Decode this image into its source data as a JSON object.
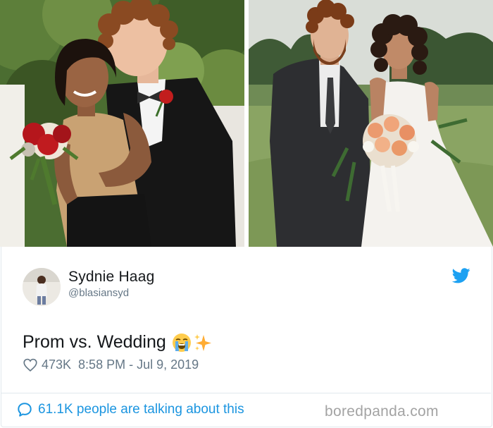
{
  "photos": {
    "left": {
      "alt": "Prom photo"
    },
    "right": {
      "alt": "Wedding photo"
    }
  },
  "tweet": {
    "display_name": "Sydnie Haag",
    "handle": "@blasiansyd",
    "text": "Prom vs. Wedding",
    "emojis": [
      "loudly-crying-face-emoji",
      "sparkles-emoji"
    ],
    "likes": "473K",
    "timestamp": "8:58 PM - Jul 9, 2019",
    "talking": "61.1K people are talking about this"
  },
  "icons": {
    "platform": "twitter-bird-icon",
    "like": "heart-icon",
    "reply": "speech-bubble-icon"
  },
  "watermark": "boredpanda.com",
  "colors": {
    "link_blue": "#1b95e0",
    "muted_text": "#657786",
    "border": "#e1e8ed",
    "twitter_blue": "#1da1f2"
  }
}
